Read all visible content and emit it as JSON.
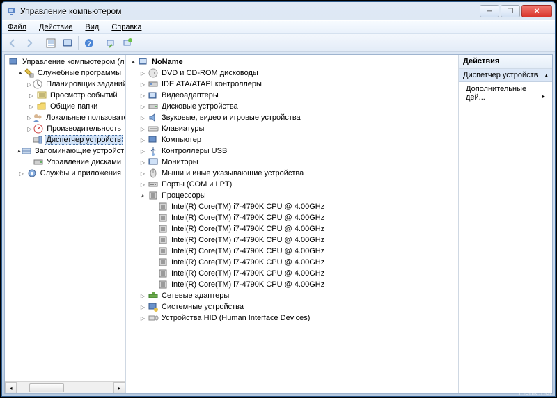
{
  "title": "Управление компьютером",
  "menu": {
    "file": "Файл",
    "action": "Действие",
    "view": "Вид",
    "help": "Справка"
  },
  "leftTree": {
    "root": "Управление компьютером (л",
    "svc": "Служебные программы",
    "svcItems": [
      "Планировщик заданий",
      "Просмотр событий",
      "Общие папки",
      "Локальные пользовате",
      "Производительность",
      "Диспетчер устройств"
    ],
    "storage": "Запоминающие устройст",
    "storageItems": [
      "Управление дисками"
    ],
    "services": "Службы и приложения"
  },
  "centerTree": {
    "root": "NoName",
    "cats": [
      "DVD и CD-ROM дисководы",
      "IDE ATA/ATAPI контроллеры",
      "Видеоадаптеры",
      "Дисковые устройства",
      "Звуковые, видео и игровые устройства",
      "Клавиатуры",
      "Компьютер",
      "Контроллеры USB",
      "Мониторы",
      "Мыши и иные указывающие устройства",
      "Порты (COM и LPT)"
    ],
    "cpuCat": "Процессоры",
    "cpu": "Intel(R) Core(TM) i7-4790K CPU @ 4.00GHz",
    "catsAfter": [
      "Сетевые адаптеры",
      "Системные устройства",
      "Устройства HID (Human Interface Devices)"
    ]
  },
  "actions": {
    "header": "Действия",
    "section": "Диспетчер устройств",
    "more": "Дополнительные дей..."
  },
  "watermark": "Fishki.net"
}
